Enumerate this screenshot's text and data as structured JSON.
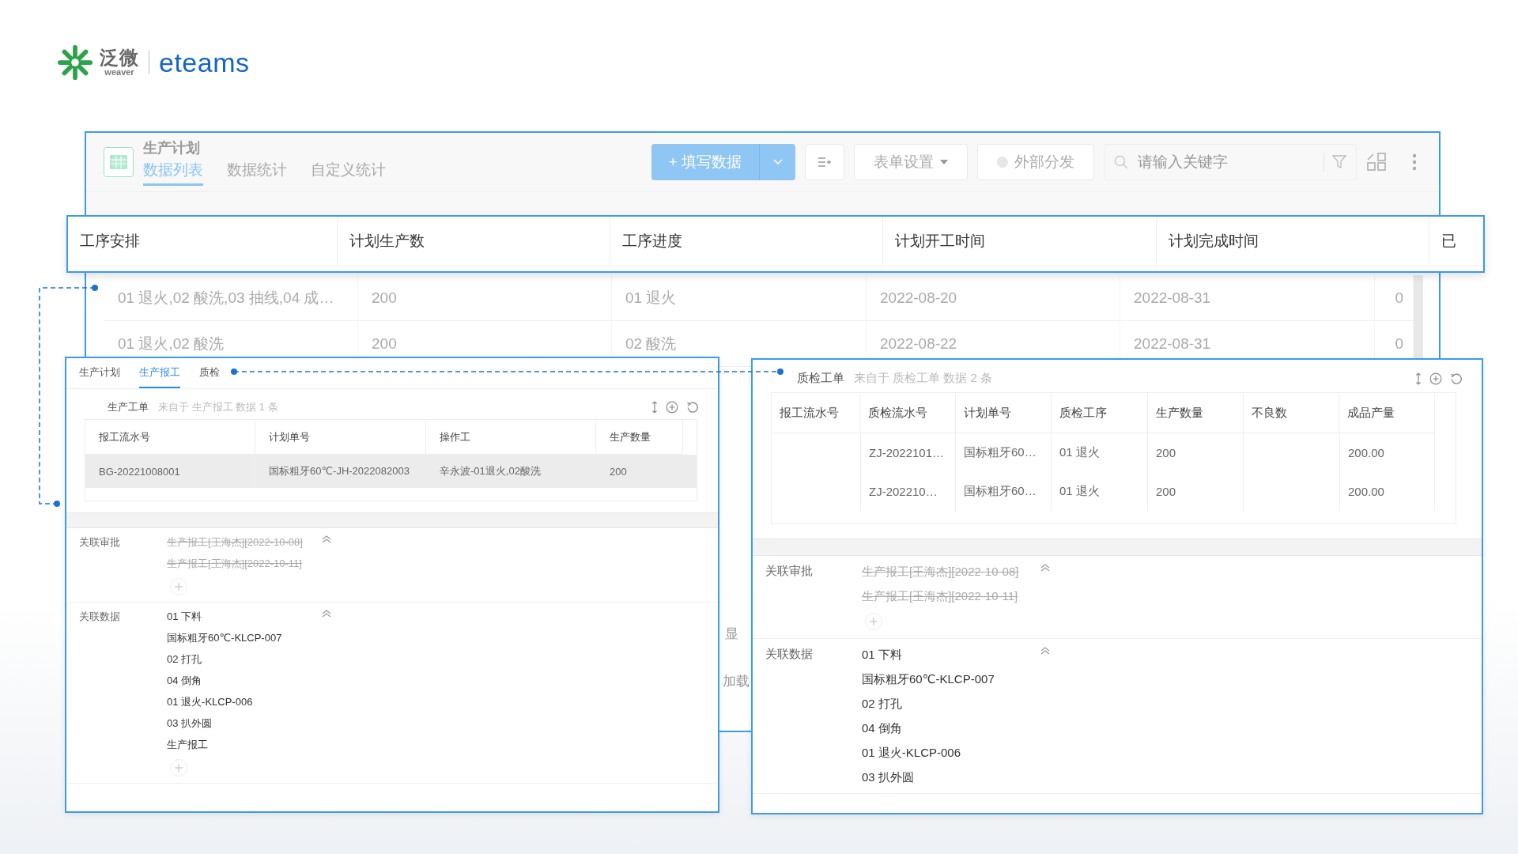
{
  "logo": {
    "brand_cn": "泛微",
    "brand_en": "weaver",
    "product": "eteams"
  },
  "app": {
    "title": "生产计划",
    "tabs": [
      {
        "label": "数据列表",
        "selected": true
      },
      {
        "label": "数据统计",
        "selected": false
      },
      {
        "label": "自定义统计",
        "selected": false
      }
    ],
    "primary_button": "+ 填写数据",
    "settings_button": "表单设置",
    "share_button": "外部分发",
    "search": {
      "placeholder": "请输入关键字"
    }
  },
  "table": {
    "columns": [
      "工序安排",
      "计划生产数",
      "工序进度",
      "计划开工时间",
      "计划完成时间",
      "已"
    ],
    "rows": [
      [
        "01 退火,02 酸洗,03 抽线,04 成…",
        "200",
        "01 退火",
        "2022-08-20",
        "2022-08-31",
        "0"
      ],
      [
        "01 退火,02 酸洗",
        "200",
        "02 酸洗",
        "2022-08-22",
        "2022-08-31",
        "0"
      ]
    ]
  },
  "covered_texts": [
    "显",
    "加载"
  ],
  "left_panel": {
    "tabs": [
      {
        "label": "生产计划",
        "selected": false
      },
      {
        "label": "生产报工",
        "selected": true
      },
      {
        "label": "质检",
        "selected": false
      }
    ],
    "section": {
      "title": "生产工单",
      "source": "来自于 生产报工 数据 1 条"
    },
    "columns": [
      "报工流水号",
      "计划单号",
      "操作工",
      "生产数量"
    ],
    "rows": [
      {
        "highlighted": true,
        "cells": [
          "BG-20221008001",
          "国标粗牙60℃-JH-2022082003",
          "辛永波-01退火,02酸洗",
          "200"
        ]
      }
    ],
    "approvals": {
      "label": "关联审批",
      "items": [
        {
          "text": "生产报工[王海杰][2022-10-08]",
          "crossed_out": true
        },
        {
          "text": "生产报工[王海杰][2022-10-11]",
          "crossed_out": true
        }
      ]
    },
    "related": {
      "label": "关联数据",
      "items": [
        "01 下料",
        "国标粗牙60℃-KLCP-007",
        "02 打孔",
        "04 倒角",
        "01 退火-KLCP-006",
        "03 扒外圆",
        "生产报工"
      ]
    }
  },
  "right_panel": {
    "section": {
      "title": "质检工单",
      "source": "来自于 质检工单 数据 2 条"
    },
    "columns": [
      "报工流水号",
      "质检流水号",
      "计划单号",
      "质检工序",
      "生产数量",
      "不良数",
      "成品产量"
    ],
    "rows": [
      {
        "cells": [
          null,
          "ZJ-2022101…",
          "国标粗牙60…",
          "01 退火",
          "200",
          null,
          "200.00"
        ]
      },
      {
        "cells": [
          null,
          "ZJ-202210…",
          "国标粗牙60…",
          "01 退火",
          "200",
          null,
          "200.00"
        ]
      }
    ],
    "approvals": {
      "label": "关联审批",
      "items": [
        {
          "text": "生产报工[王海杰][2022-10-08]",
          "crossed_out": true
        },
        {
          "text": "生产报工[王海杰][2022-10-11]",
          "crossed_out": true
        }
      ]
    },
    "related": {
      "label": "关联数据",
      "items": [
        "01 下料",
        "国标粗牙60℃-KLCP-007",
        "02 打孔",
        "04 倒角",
        "01 退火-KLCP-006",
        "03 扒外圆"
      ]
    }
  }
}
